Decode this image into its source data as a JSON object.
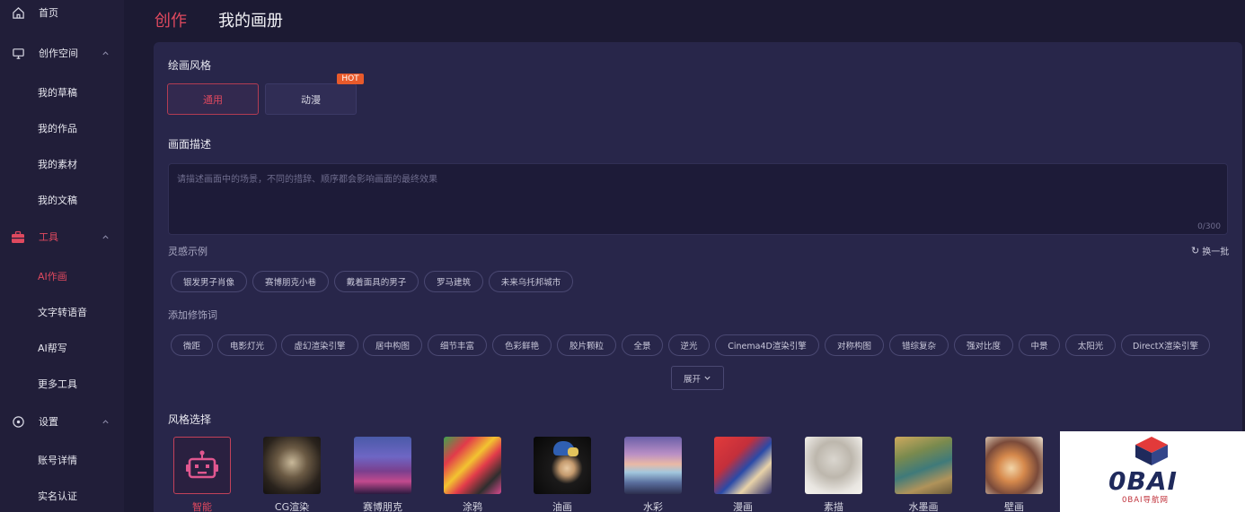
{
  "sidebar": {
    "items": [
      {
        "label": "首页"
      },
      {
        "label": "创作空间"
      },
      {
        "label": "我的草稿"
      },
      {
        "label": "我的作品"
      },
      {
        "label": "我的素材"
      },
      {
        "label": "我的文稿"
      },
      {
        "label": "工具"
      },
      {
        "label": "AI作画"
      },
      {
        "label": "文字转语音"
      },
      {
        "label": "AI帮写"
      },
      {
        "label": "更多工具"
      },
      {
        "label": "设置"
      },
      {
        "label": "账号详情"
      },
      {
        "label": "实名认证"
      }
    ]
  },
  "header": {
    "tabs": [
      {
        "label": "创作"
      },
      {
        "label": "我的画册"
      }
    ]
  },
  "painting_style": {
    "title": "绘画风格",
    "options": [
      {
        "label": "通用"
      },
      {
        "label": "动漫"
      }
    ],
    "hot_badge": "HOT"
  },
  "description": {
    "title": "画面描述",
    "placeholder": "请描述画面中的场景，不同的措辞、顺序都会影响画面的最终效果",
    "counter": "0/300"
  },
  "inspiration": {
    "title": "灵感示例",
    "refresh": "换一批",
    "chips": [
      "银发男子肖像",
      "赛博朋克小巷",
      "戴着面具的男子",
      "罗马建筑",
      "未来乌托邦城市"
    ]
  },
  "modifiers": {
    "title": "添加修饰词",
    "chips": [
      "微距",
      "电影灯光",
      "虚幻渲染引擎",
      "居中构图",
      "细节丰富",
      "色彩鲜艳",
      "胶片颗粒",
      "全景",
      "逆光",
      "Cinema4D渲染引擎",
      "对称构图",
      "错综复杂",
      "强对比度",
      "中景",
      "太阳光",
      "DirectX渲染引擎"
    ],
    "expand": "展开"
  },
  "style_select": {
    "title": "风格选择",
    "styles": [
      {
        "label": "智能"
      },
      {
        "label": "CG渲染"
      },
      {
        "label": "赛博朋克"
      },
      {
        "label": "涂鸦"
      },
      {
        "label": "油画"
      },
      {
        "label": "水彩"
      },
      {
        "label": "漫画"
      },
      {
        "label": "素描"
      },
      {
        "label": "水墨画"
      },
      {
        "label": "壁画"
      }
    ]
  },
  "watermark": {
    "logo": "0BAI",
    "sub": "0BAI导航网"
  },
  "colors": {
    "accent": "#e0495f",
    "bg": "#1c1a33",
    "panel": "#28264a",
    "sidebar": "#211e39"
  }
}
